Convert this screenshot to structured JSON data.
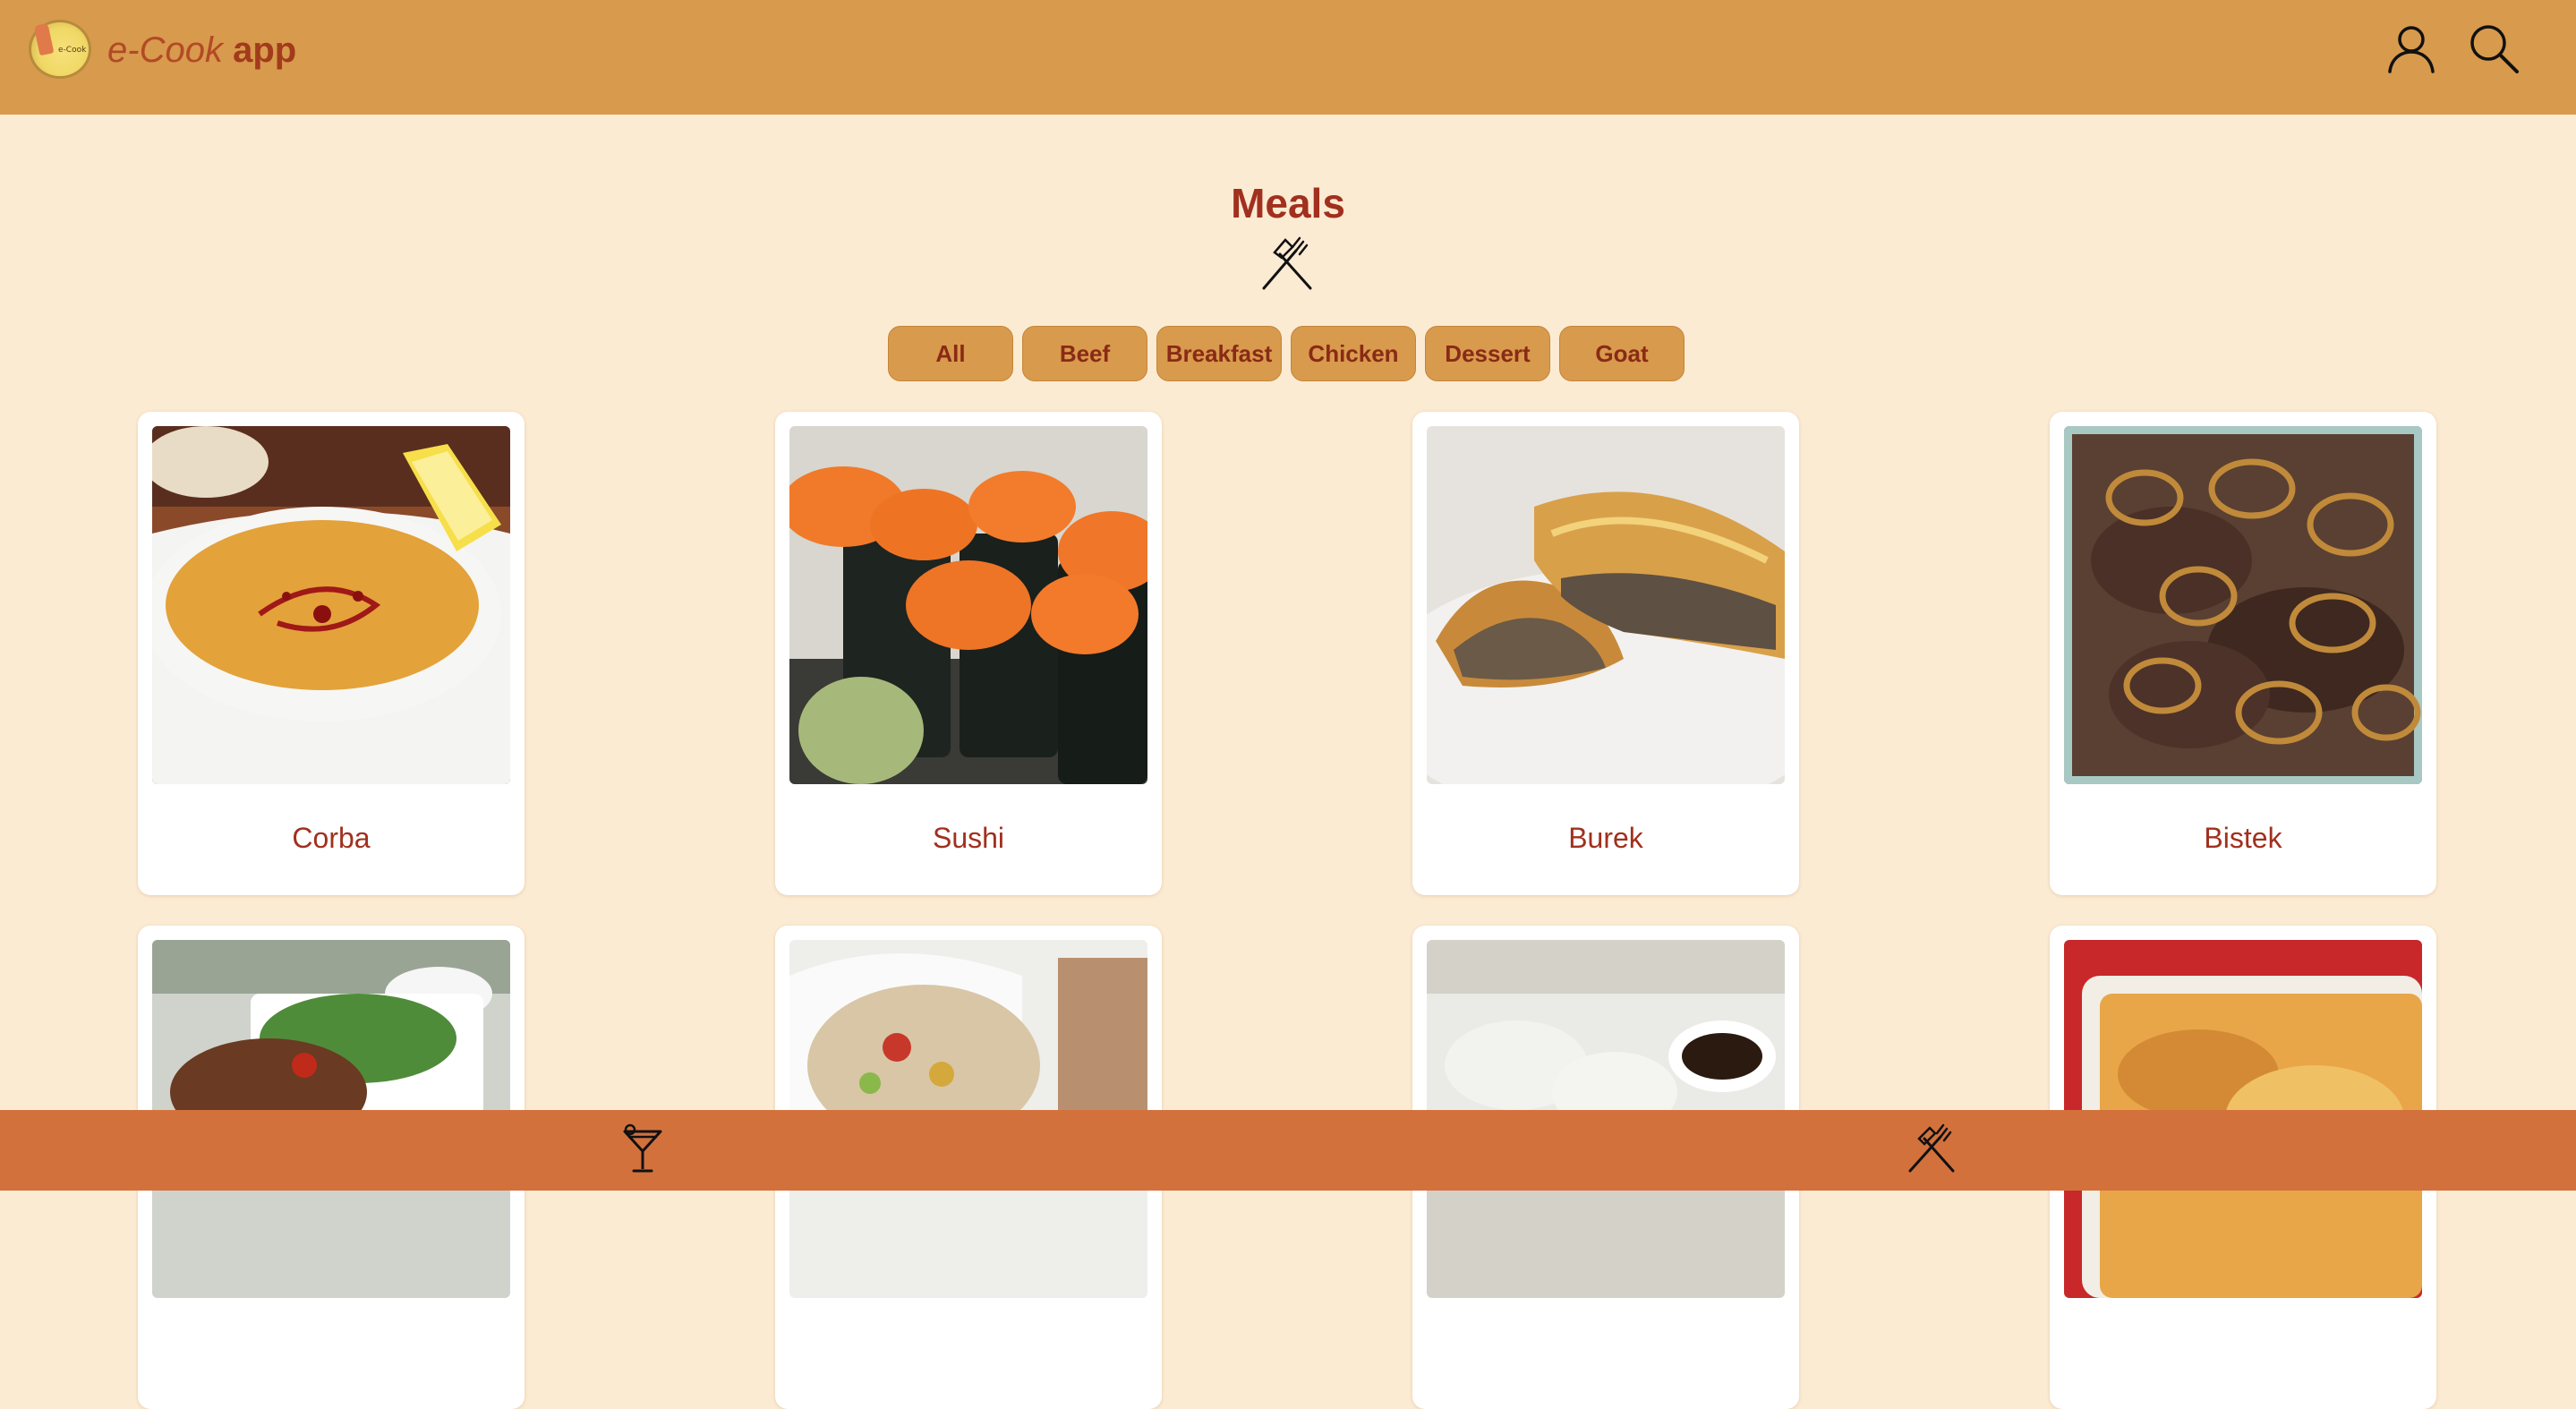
{
  "header": {
    "brand_light": "e-Cook",
    "brand_bold": "app",
    "profile_icon": "user-icon",
    "search_icon": "search-icon"
  },
  "page": {
    "title": "Meals",
    "title_icon": "fork-knife-icon"
  },
  "filters": [
    "All",
    "Beef",
    "Breakfast",
    "Chicken",
    "Dessert",
    "Goat"
  ],
  "meals": [
    {
      "name": "Corba"
    },
    {
      "name": "Sushi"
    },
    {
      "name": "Burek"
    },
    {
      "name": "Bistek"
    }
  ],
  "footer": {
    "drinks_icon": "cocktail-icon",
    "meals_icon": "fork-knife-icon"
  },
  "colors": {
    "header_bg": "#d89a4c",
    "page_bg": "#fcebd3",
    "accent_text": "#a1301e",
    "footer_bg": "#d3713d"
  }
}
